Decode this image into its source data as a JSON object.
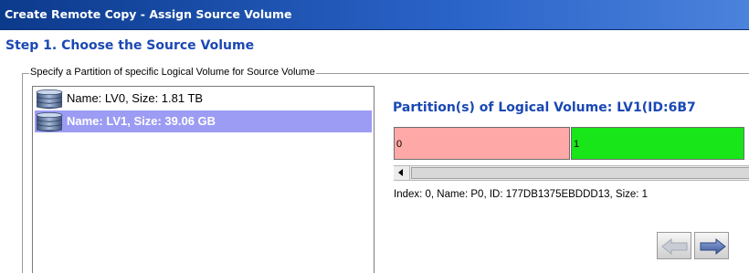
{
  "window": {
    "title": "Create Remote Copy - Assign Source Volume"
  },
  "step": {
    "heading": "Step 1. Choose the Source Volume"
  },
  "source_group": {
    "legend": "Specify a Partition of specific Logical Volume for Source Volume"
  },
  "volumes": [
    {
      "label": "Name: LV0, Size: 1.81 TB",
      "selected": false,
      "icon": "database-icon"
    },
    {
      "label": "Name: LV1, Size: 39.06 GB",
      "selected": true,
      "icon": "database-icon"
    }
  ],
  "partition_panel": {
    "title": "Partition(s) of Logical Volume: LV1(ID:6B7",
    "partitions": [
      {
        "label": "0",
        "color": "#ffa8a8"
      },
      {
        "label": "1",
        "color": "#19e619"
      }
    ],
    "info": "Index: 0, Name: P0, ID: 177DB1375EBDDD13, Size: 1"
  },
  "navigation": {
    "prev_icon": "arrow-left-icon",
    "next_icon": "arrow-right-icon"
  }
}
